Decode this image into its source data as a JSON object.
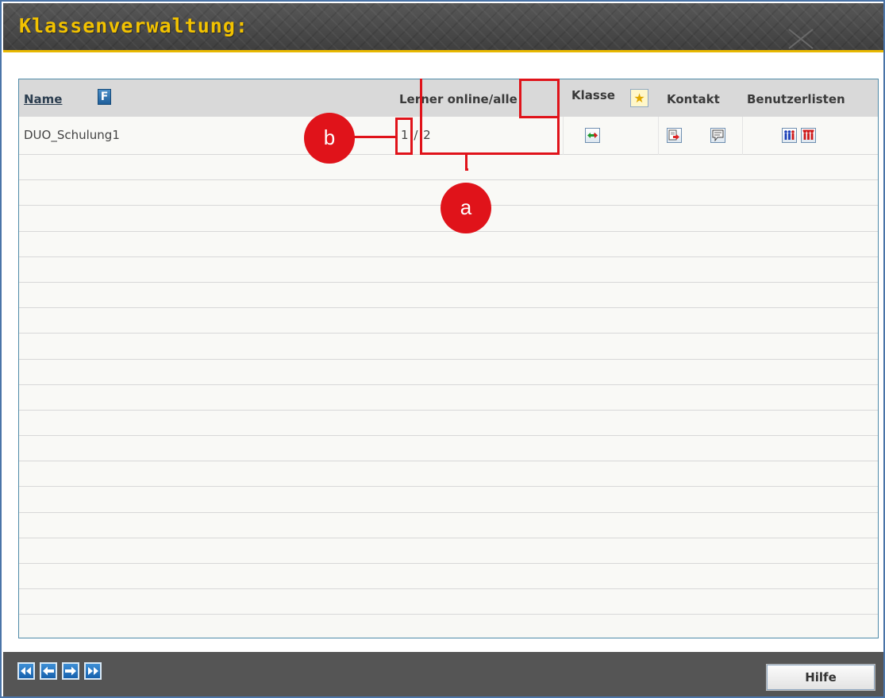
{
  "header": {
    "title": "Klassenverwaltung:"
  },
  "table": {
    "columns": {
      "name": "Name",
      "filter_icon_label": "F",
      "lerner": "Lerner online/alle",
      "klasse": "Klasse",
      "kontakt": "Kontakt",
      "benutzerlisten": "Benutzerlisten"
    },
    "rows": [
      {
        "name": "DUO_Schulung1",
        "online": "1",
        "separator": "/",
        "total": "2"
      }
    ]
  },
  "annotations": {
    "a": "a",
    "b": "b"
  },
  "footer": {
    "nav_icons": [
      "first-page-icon",
      "previous-page-icon",
      "next-page-icon",
      "last-page-icon"
    ],
    "help_label": "Hilfe"
  },
  "colors": {
    "title_text": "#f2c200",
    "accent_line": "#e8b800",
    "annotation": "#e0131a",
    "panel_border": "#4f8aa8",
    "header_row_bg": "#d9d9d9"
  }
}
